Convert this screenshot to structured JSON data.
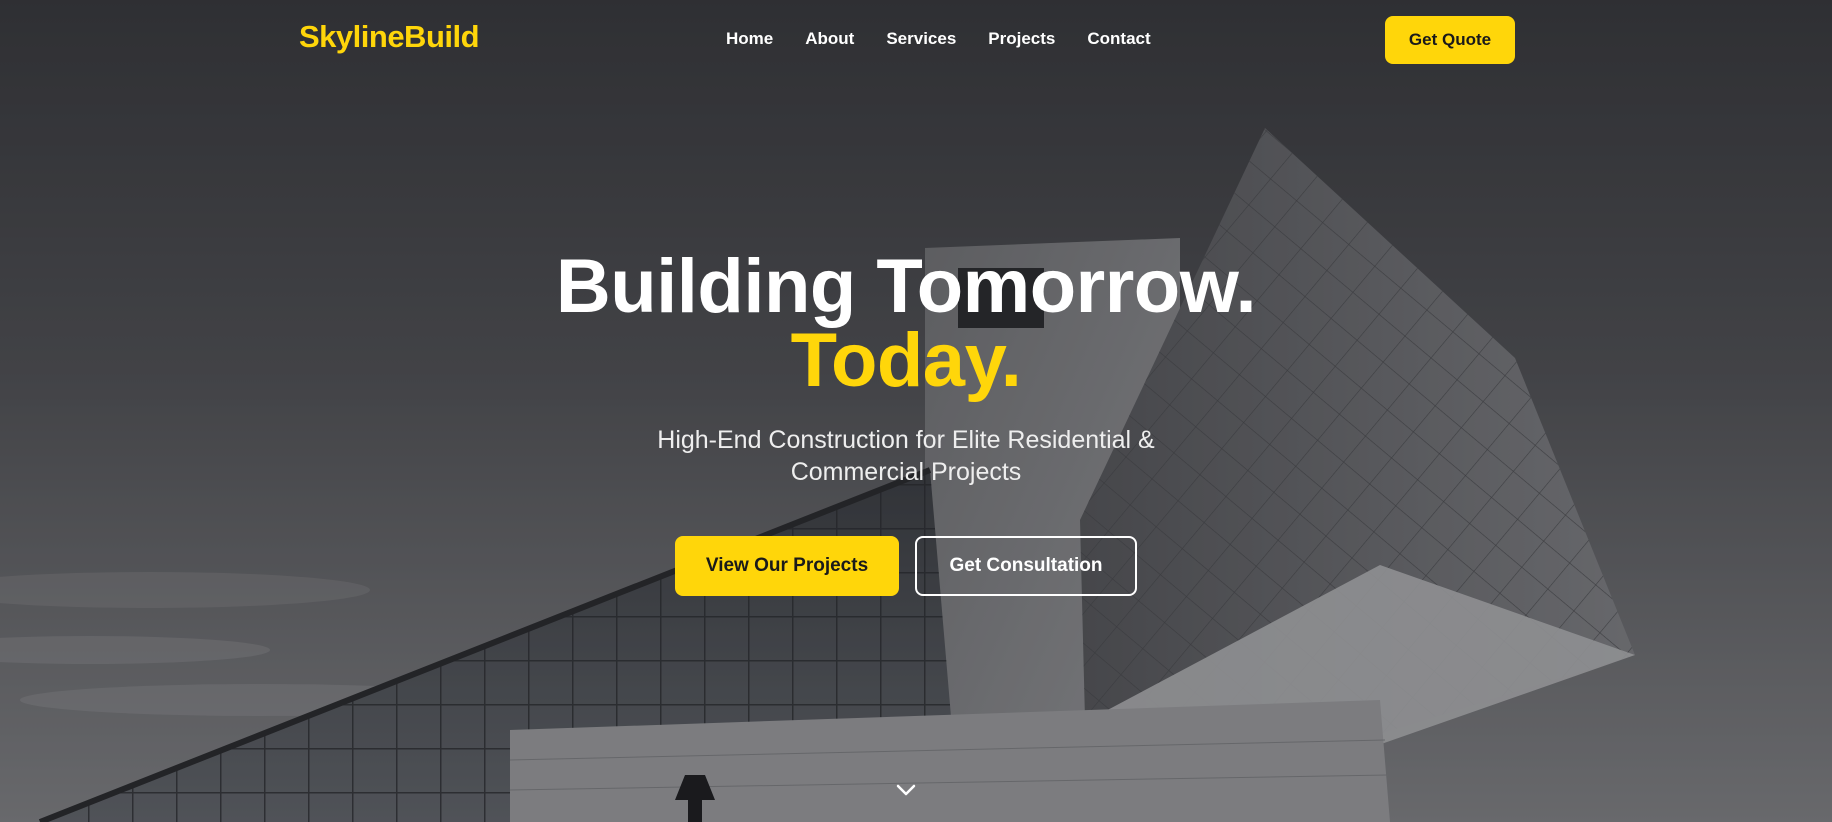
{
  "brand": {
    "name": "SkylineBuild",
    "color": "#FFD60A"
  },
  "nav": {
    "links": [
      {
        "label": "Home"
      },
      {
        "label": "About"
      },
      {
        "label": "Services"
      },
      {
        "label": "Projects"
      },
      {
        "label": "Contact"
      }
    ],
    "cta_label": "Get Quote"
  },
  "hero": {
    "headline_line1": "Building Tomorrow.",
    "headline_line2": "Today.",
    "subheadline": "High-End Construction for Elite Residential & Commercial Projects",
    "primary_button": "View Our Projects",
    "secondary_button": "Get Consultation",
    "scroll_icon": "chevron-down-icon",
    "background_image": "modern-glass-building-photo"
  },
  "colors": {
    "accent": "#FFD60A",
    "text_light": "#FFFFFF",
    "text_dark": "#1A1A1A"
  }
}
